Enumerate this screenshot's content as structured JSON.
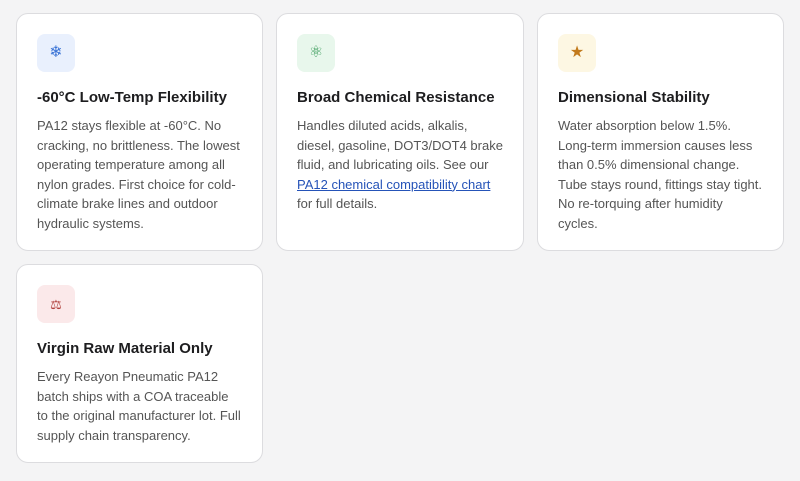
{
  "cards": [
    {
      "icon": "snowflake-icon",
      "title": "-60°C Low-Temp Flexibility",
      "body": "PA12 stays flexible at -60°C. No cracking, no brittleness. The lowest operating temperature among all nylon grades. First choice for cold-climate brake lines and outdoor hydraulic systems."
    },
    {
      "icon": "atom-icon",
      "title": "Broad Chemical Resistance",
      "body_before": "Handles diluted acids, alkalis, diesel, gasoline, DOT3/DOT4 brake fluid, and lubricating oils. See our",
      "link_text": "PA12 chemical compatibility chart",
      "body_after": "for full details."
    },
    {
      "icon": "star-icon",
      "title": "Dimensional Stability",
      "body": "Water absorption below 1.5%. Long-term immersion causes less than 0.5% dimensional change. Tube stays round, fittings stay tight. No re-torquing after humidity cycles."
    },
    {
      "icon": "scale-icon",
      "title": "Virgin Raw Material Only",
      "body": "Every Reayon Pneumatic PA12 batch ships with a COA traceable to the original manufacturer lot. Full supply chain transparency."
    }
  ],
  "icons": {
    "snowflake": "❄",
    "atom": "⚛",
    "star": "★",
    "scale": "⚖"
  },
  "colors": {
    "link": "#2553b8",
    "snowflake": "#3b74d6",
    "atom": "#3a9b5a",
    "star": "#c27a1c",
    "scale": "#b0403c"
  }
}
